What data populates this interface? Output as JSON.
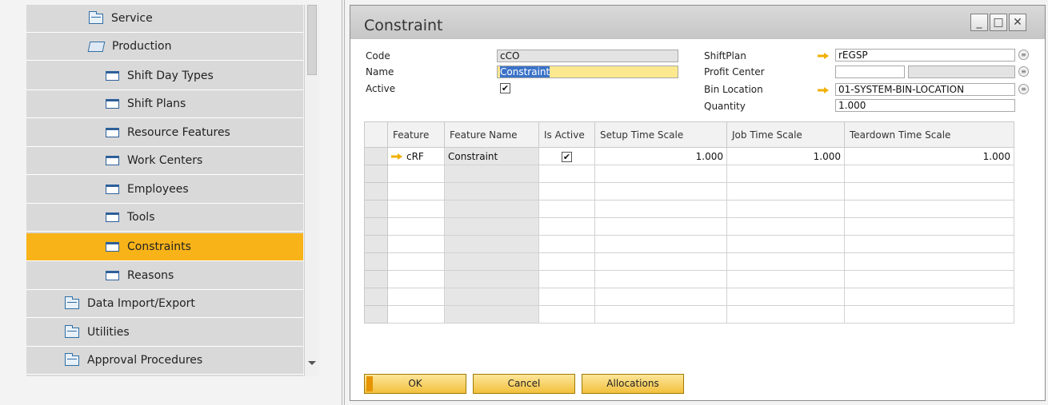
{
  "nav": {
    "items": [
      {
        "label": "Service",
        "icon": "folder-icon"
      },
      {
        "label": "Production",
        "icon": "open-folder-icon"
      },
      {
        "label": "Shift Day Types",
        "icon": "form-icon"
      },
      {
        "label": "Shift Plans",
        "icon": "form-icon"
      },
      {
        "label": "Resource Features",
        "icon": "form-icon"
      },
      {
        "label": "Work Centers",
        "icon": "form-icon"
      },
      {
        "label": "Employees",
        "icon": "form-icon"
      },
      {
        "label": "Tools",
        "icon": "form-icon"
      },
      {
        "label": "Constraints",
        "icon": "form-icon",
        "selected": true
      },
      {
        "label": "Reasons",
        "icon": "form-icon"
      },
      {
        "label": "Data Import/Export",
        "icon": "folder-icon"
      },
      {
        "label": "Utilities",
        "icon": "folder-icon"
      },
      {
        "label": "Approval Procedures",
        "icon": "folder-icon"
      }
    ],
    "selected_color": "#f8b319"
  },
  "window": {
    "title": "Constraint",
    "minimize": "_",
    "maximize": "□",
    "close": "✕"
  },
  "header": {
    "code_label": "Code",
    "code_value": "cCO",
    "name_label": "Name",
    "name_value": "Constraint",
    "active_label": "Active",
    "active_checked": true,
    "shiftplan_label": "ShiftPlan",
    "shiftplan_value": "rEGSP",
    "profit_center_label": "Profit Center",
    "profit_center_value": "",
    "profit_center_value2": "",
    "bin_location_label": "Bin Location",
    "bin_location_value": "01-SYSTEM-BIN-LOCATION",
    "quantity_label": "Quantity",
    "quantity_value": "1.000",
    "check_mark": "✔",
    "list_icon": "≡"
  },
  "grid": {
    "columns": [
      "Feature",
      "Feature Name",
      "Is Active",
      "Setup Time Scale",
      "Job Time Scale",
      "Teardown Time Scale"
    ],
    "rows": [
      {
        "feature": "cRF",
        "feature_name": "Constraint",
        "is_active": true,
        "setup_time_scale": "1.000",
        "job_time_scale": "1.000",
        "teardown_time_scale": "1.000"
      }
    ],
    "empty_rows": 9
  },
  "buttons": {
    "ok": "OK",
    "cancel": "Cancel",
    "allocations": "Allocations"
  },
  "colors": {
    "link_arrow": "#f0b000",
    "button_top": "#fde69b",
    "button_bottom": "#f2c03c"
  }
}
